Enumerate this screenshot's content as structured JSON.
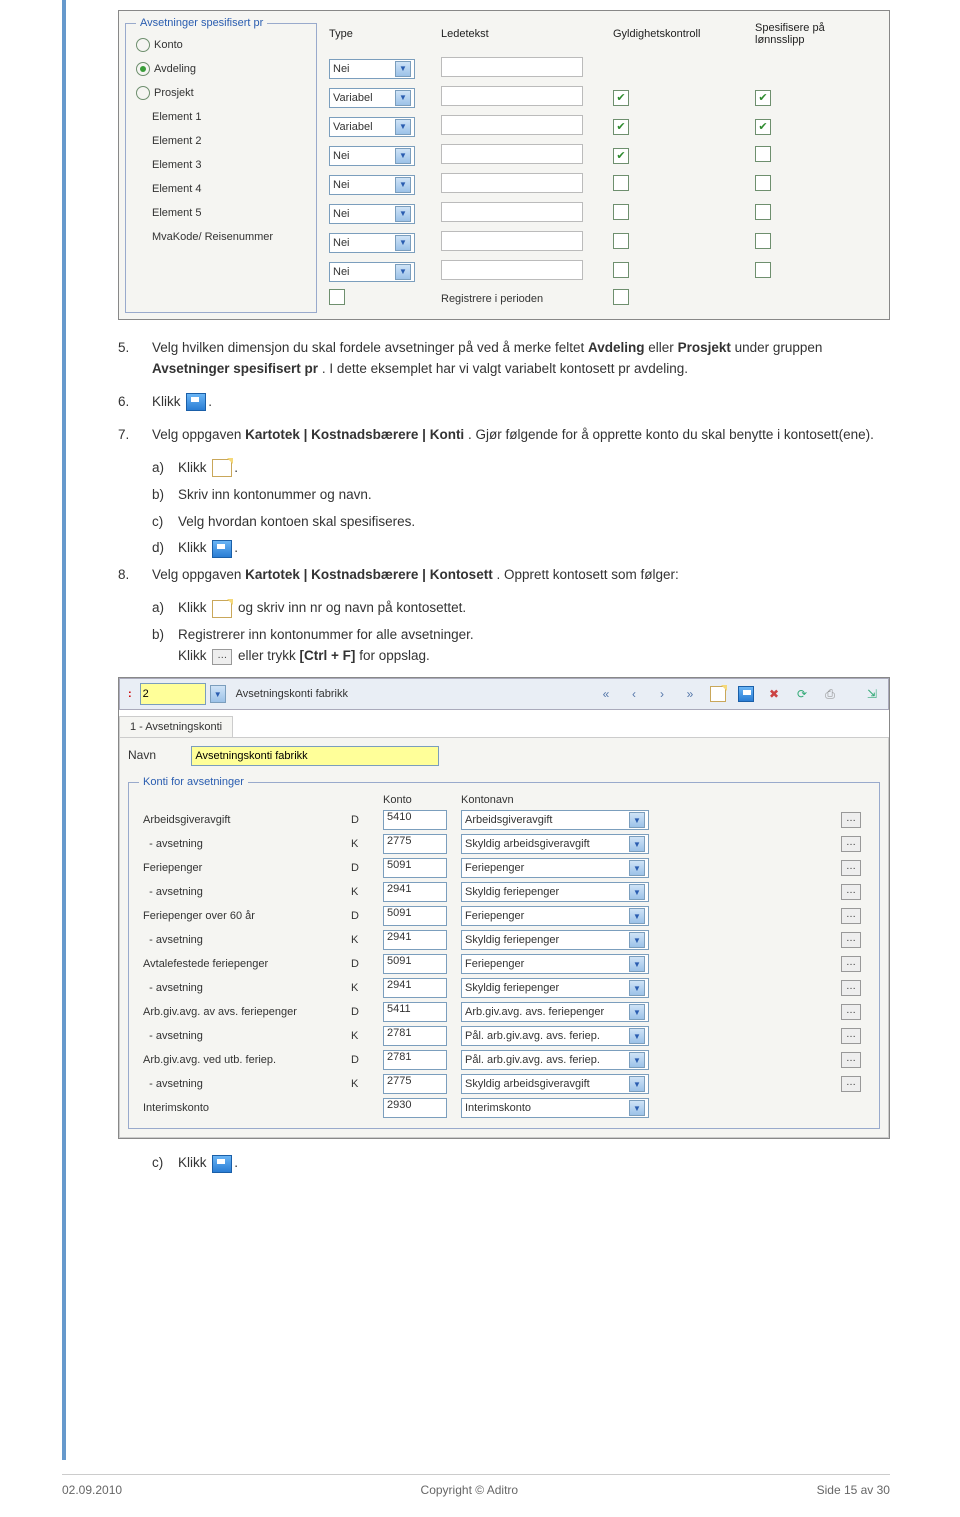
{
  "panel1": {
    "legend": "Avsetninger spesifisert pr",
    "radios": [
      "Konto",
      "Avdeling",
      "Prosjekt",
      "Element 1",
      "Element 2",
      "Element 3",
      "Element 4",
      "Element 5",
      "MvaKode/\nReisenummer"
    ],
    "cols": [
      "Type",
      "Ledetekst",
      "Gyldighetskontroll",
      "Spesifisere på lønnsslipp"
    ],
    "rows": [
      {
        "type": "Nei"
      },
      {
        "type": "Variabel"
      },
      {
        "type": "Variabel"
      },
      {
        "type": "Nei"
      },
      {
        "type": "Nei"
      },
      {
        "type": "Nei"
      },
      {
        "type": "Nei"
      },
      {
        "type": "Nei"
      }
    ],
    "reg_label": "Registrere i perioden"
  },
  "text": {
    "dot": ".",
    "s5": {
      "num": "5.",
      "a": "Velg hvilken dimensjon du skal fordele avsetninger på ved å merke feltet ",
      "b1": "Avdeling",
      "c": " eller ",
      "b2": "Prosjekt",
      "d": " under gruppen ",
      "b3": "Avsetninger spesifisert pr",
      "e": ". I dette eksemplet har vi valgt variabelt kontosett pr avdeling."
    },
    "s6": {
      "num": "6.",
      "a": "Klikk "
    },
    "s7": {
      "num": "7.",
      "a": "Velg oppgaven ",
      "b1": "Kartotek | Kostnadsbærere | Konti",
      "c": ". Gjør følgende for å opprette konto du skal benytte i kontosett(ene)."
    },
    "s7a": {
      "num": "a)",
      "a": "Klikk "
    },
    "s7b": {
      "num": "b)",
      "a": "Skriv inn kontonummer og navn."
    },
    "s7c": {
      "num": "c)",
      "a": "Velg hvordan kontoen skal spesifiseres."
    },
    "s7d": {
      "num": "d)",
      "a": "Klikk "
    },
    "s8": {
      "num": "8.",
      "a": "Velg oppgaven ",
      "b1": "Kartotek | Kostnadsbærere | Kontosett",
      "c": ". Opprett kontosett som følger:"
    },
    "s8a": {
      "num": "a)",
      "a": "Klikk ",
      "b": " og skriv inn nr og navn på kontosettet."
    },
    "s8b": {
      "num": "b)",
      "a": "Registrerer inn kontonummer for alle avsetninger.",
      "b": "Klikk ",
      "c": " eller trykk ",
      "d": "[Ctrl + F]",
      "e": " for oppslag."
    },
    "s8c": {
      "num": "c)",
      "a": "Klikk "
    }
  },
  "panel2": {
    "toolbar": {
      "id": "2",
      "title": "Avsetningskonti fabrikk"
    },
    "tab": "1 - Avsetningskonti",
    "navn_label": "Navn",
    "navn": "Avsetningskonti fabrikk",
    "legend": "Konti for avsetninger",
    "cols": [
      "Konto",
      "Kontonavn"
    ],
    "rows": [
      {
        "label": "Arbeidsgiveravgift",
        "dk": "D",
        "konto": "5410",
        "navn": "Arbeidsgiveravgift",
        "lookup": true
      },
      {
        "label": "  - avsetning",
        "dk": "K",
        "konto": "2775",
        "navn": "Skyldig arbeidsgiveravgift",
        "lookup": true
      },
      {
        "label": "Feriepenger",
        "dk": "D",
        "konto": "5091",
        "navn": "Feriepenger",
        "lookup": true
      },
      {
        "label": "  - avsetning",
        "dk": "K",
        "konto": "2941",
        "navn": "Skyldig feriepenger",
        "lookup": true
      },
      {
        "label": "Feriepenger over 60 år",
        "dk": "D",
        "konto": "5091",
        "navn": "Feriepenger",
        "lookup": true
      },
      {
        "label": "  - avsetning",
        "dk": "K",
        "konto": "2941",
        "navn": "Skyldig feriepenger",
        "lookup": true
      },
      {
        "label": "Avtalefestede feriepenger",
        "dk": "D",
        "konto": "5091",
        "navn": "Feriepenger",
        "lookup": true
      },
      {
        "label": "  - avsetning",
        "dk": "K",
        "konto": "2941",
        "navn": "Skyldig feriepenger",
        "lookup": true
      },
      {
        "label": "Arb.giv.avg. av avs. feriepenger",
        "dk": "D",
        "konto": "5411",
        "navn": "Arb.giv.avg. avs. feriepenger",
        "lookup": true
      },
      {
        "label": "  - avsetning",
        "dk": "K",
        "konto": "2781",
        "navn": "Pål. arb.giv.avg. avs. feriep.",
        "lookup": true
      },
      {
        "label": "Arb.giv.avg. ved utb. feriep.",
        "dk": "D",
        "konto": "2781",
        "navn": "Pål. arb.giv.avg. avs. feriep.",
        "lookup": true
      },
      {
        "label": "  - avsetning",
        "dk": "K",
        "konto": "2775",
        "navn": "Skyldig arbeidsgiveravgift",
        "lookup": true
      },
      {
        "label": "Interimskonto",
        "dk": "",
        "konto": "2930",
        "navn": "Interimskonto",
        "lookup": false
      }
    ]
  },
  "footer": {
    "date": "02.09.2010",
    "copyright": "Copyright © Aditro",
    "page": "Side 15 av 30"
  }
}
